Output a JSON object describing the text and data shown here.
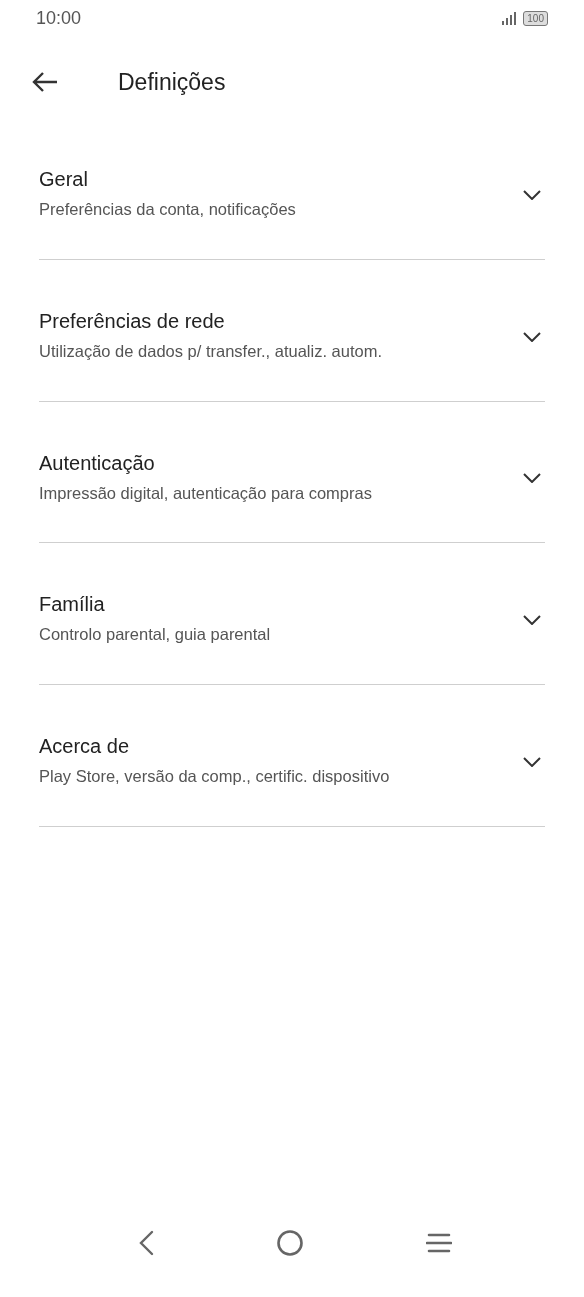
{
  "status_bar": {
    "time": "10:00",
    "battery": "100"
  },
  "header": {
    "title": "Definições"
  },
  "sections": [
    {
      "title": "Geral",
      "subtitle": "Preferências da conta, notificações",
      "expanded": false
    },
    {
      "title": "Preferências de rede",
      "subtitle": "Utilização de dados p/ transfer., atualiz. autom.",
      "expanded": false
    },
    {
      "title": "Autenticação",
      "subtitle": "Impressão digital, autenticação para compras",
      "expanded": false
    },
    {
      "title": "Família",
      "subtitle": "Controlo parental, guia parental",
      "expanded": false
    },
    {
      "title": "Acerca de",
      "subtitle": "Play Store, versão da comp., certific. dispositivo",
      "expanded": false
    }
  ]
}
